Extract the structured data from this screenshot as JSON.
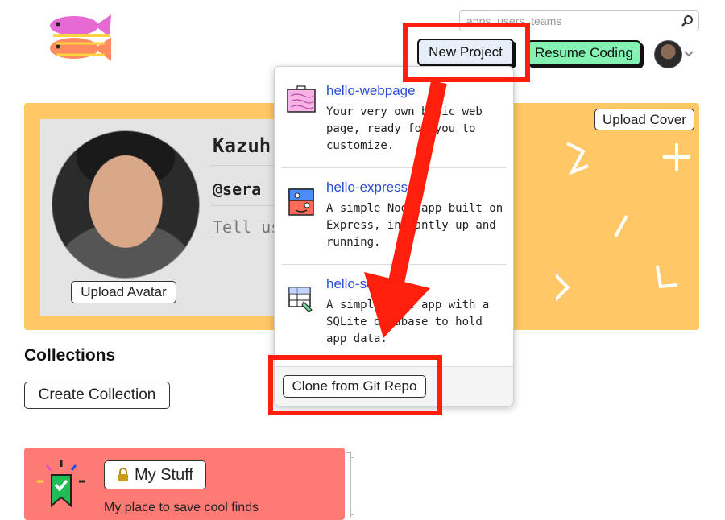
{
  "header": {
    "search_placeholder": "apps, users, teams",
    "new_project_label": "New Project",
    "resume_coding_label": "Resume Coding"
  },
  "profile": {
    "name_visible": "Kazuh",
    "handle_visible": "@sera",
    "bio_placeholder_visible": "Tell us",
    "upload_avatar_label": "Upload Avatar",
    "upload_cover_label": "Upload Cover"
  },
  "new_project_menu": {
    "items": [
      {
        "title": "hello-webpage",
        "description": "Your very own basic web page, ready for you to customize.",
        "icon": "webpage-icon"
      },
      {
        "title": "hello-express",
        "description": "A simple Node app built on Express, instantly up and running.",
        "icon": "express-icon"
      },
      {
        "title": "hello-sqlite",
        "description": "A simple Node app with a SQLite database to hold app data.",
        "icon": "sqlite-icon"
      }
    ],
    "clone_label": "Clone from Git Repo"
  },
  "collections": {
    "title": "Collections",
    "create_label": "Create Collection",
    "cards": [
      {
        "title": "My Stuff",
        "description": "My place to save cool finds"
      }
    ]
  },
  "colors": {
    "cover": "#ffc765",
    "resume_button": "#84f2b2",
    "collection_card": "#fe7a74",
    "highlight": "#ff1f0c",
    "link": "#2a4fd6"
  }
}
